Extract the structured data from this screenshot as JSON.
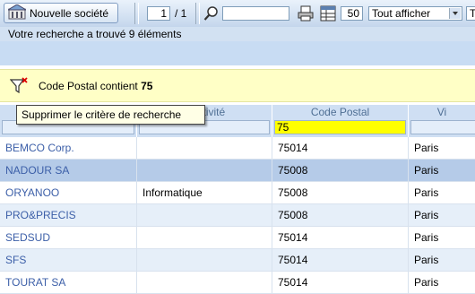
{
  "toolbar": {
    "new_company_label": "Nouvelle société",
    "page_current": "1",
    "page_total": "/ 1",
    "search_value": "",
    "rows_per_page": "50",
    "display_filter": "Tout afficher",
    "display_filter_options": [
      "Tout afficher"
    ],
    "clipped_label": "T"
  },
  "status": "Votre recherche a trouvé 9 éléments",
  "criteria": {
    "prefix": "Code Postal contient ",
    "value": "75"
  },
  "tooltip": "Supprimer le critère de recherche",
  "columns": {
    "activity_header": "d'activité",
    "postal_header": "Code Postal",
    "postal_filter": "75",
    "city_header": "Vi"
  },
  "rows": [
    {
      "name": "BEMCO Corp.",
      "activity": "",
      "postal": "75014",
      "city": "Paris"
    },
    {
      "name": "NADOUR SA",
      "activity": "",
      "postal": "75008",
      "city": "Paris"
    },
    {
      "name": "ORYANOO",
      "activity": "Informatique",
      "postal": "75008",
      "city": "Paris"
    },
    {
      "name": "PRO&PRECIS",
      "activity": "",
      "postal": "75008",
      "city": "Paris"
    },
    {
      "name": "SEDSUD",
      "activity": "",
      "postal": "75014",
      "city": "Paris"
    },
    {
      "name": "SFS",
      "activity": "",
      "postal": "75014",
      "city": "Paris"
    },
    {
      "name": "TOURAT SA",
      "activity": "",
      "postal": "75014",
      "city": "Paris"
    }
  ],
  "colors": {
    "link": "#3c5fa8",
    "selected_row": "#b5cbe8",
    "criteria_bg": "#ffffc6",
    "active_filter": "#ffff00"
  },
  "icons": [
    "building-icon",
    "search-icon",
    "print-icon",
    "table-icon",
    "filter-remove-icon",
    "chevron-down-icon"
  ]
}
